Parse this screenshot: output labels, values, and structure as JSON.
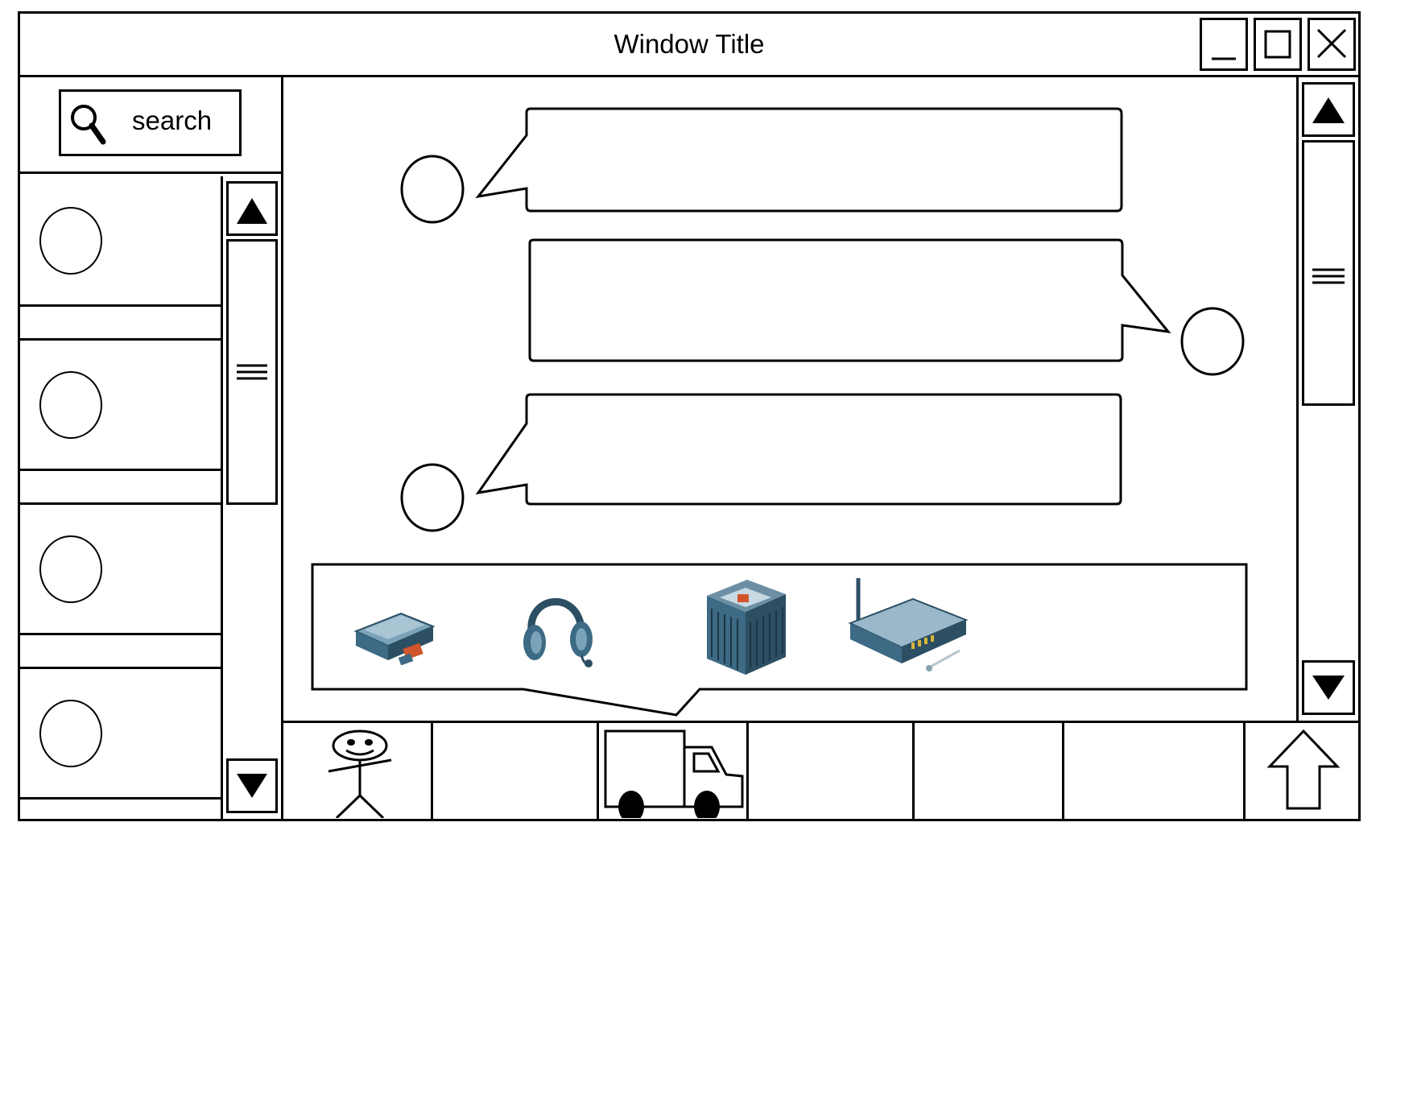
{
  "window": {
    "title": "Window Title",
    "controls": [
      "minimize-icon",
      "maximize-icon",
      "close-icon"
    ]
  },
  "search": {
    "label": "search",
    "icon": "magnifier-icon"
  },
  "sidebar": {
    "items": [
      {
        "icon": "circle-avatar-icon"
      },
      {
        "icon": "circle-avatar-icon"
      },
      {
        "icon": "circle-avatar-icon"
      },
      {
        "icon": "circle-avatar-icon"
      }
    ]
  },
  "chat": {
    "messages": [
      {
        "side": "left",
        "text": ""
      },
      {
        "side": "right",
        "text": ""
      },
      {
        "side": "left",
        "text": ""
      }
    ]
  },
  "attachments": {
    "icons": [
      "scanner-icon",
      "headset-icon",
      "server-icon",
      "wlan-router-icon"
    ]
  },
  "toolbar": {
    "tabs": [
      "person-icon",
      "",
      "truck-icon",
      "",
      "",
      "",
      "upload-arrow-icon"
    ]
  },
  "colors": {
    "stroke": "#000000",
    "background": "#ffffff",
    "device_blue": "#3d6a84"
  }
}
